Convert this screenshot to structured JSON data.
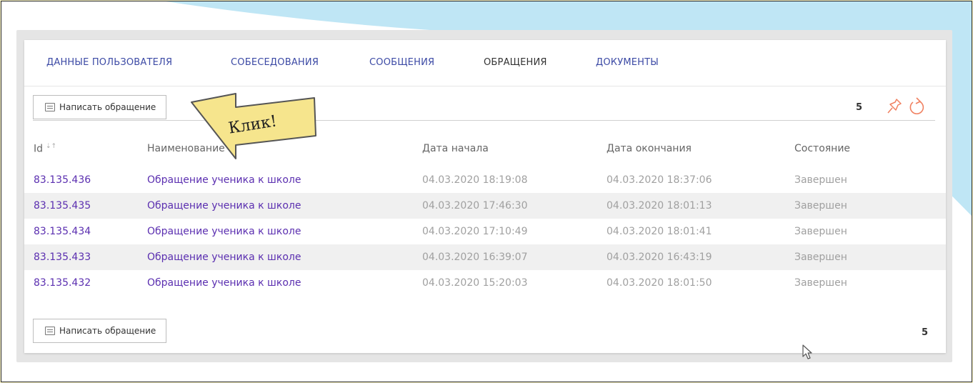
{
  "tabs": [
    {
      "label": "ДАННЫЕ ПОЛЬЗОВАТЕЛЯ",
      "active": false
    },
    {
      "label": "СОБЕСЕДОВАНИЯ",
      "active": false
    },
    {
      "label": "СООБЩЕНИЯ",
      "active": false
    },
    {
      "label": "ОБРАЩЕНИЯ",
      "active": true
    },
    {
      "label": "ДОКУМЕНТЫ",
      "active": false
    }
  ],
  "toolbar": {
    "write_button_label": "Написать обращение",
    "total_count": "5"
  },
  "table": {
    "columns": [
      "Id",
      "Наименование",
      "Дата начала",
      "Дата окончания",
      "Состояние"
    ],
    "rows": [
      {
        "id": "83.135.436",
        "name": "Обращение ученика к школе",
        "start": "04.03.2020 18:19:08",
        "end": "04.03.2020 18:37:06",
        "state": "Завершен"
      },
      {
        "id": "83.135.435",
        "name": "Обращение ученика к школе",
        "start": "04.03.2020 17:46:30",
        "end": "04.03.2020 18:01:13",
        "state": "Завершен"
      },
      {
        "id": "83.135.434",
        "name": "Обращение ученика к школе",
        "start": "04.03.2020 17:10:49",
        "end": "04.03.2020 18:01:41",
        "state": "Завершен"
      },
      {
        "id": "83.135.433",
        "name": "Обращение ученика к школе",
        "start": "04.03.2020 16:39:07",
        "end": "04.03.2020 16:43:19",
        "state": "Завершен"
      },
      {
        "id": "83.135.432",
        "name": "Обращение ученика к школе",
        "start": "04.03.2020 15:20:03",
        "end": "04.03.2020 18:01:50",
        "state": "Завершен"
      }
    ]
  },
  "footer": {
    "write_button_label": "Написать обращение",
    "total_count": "5"
  },
  "annotation": {
    "text": "Клик!"
  },
  "icons": {
    "message": "message-icon",
    "sort": "sort-icon",
    "pin": "pin-icon",
    "refresh": "refresh-icon",
    "cursor": "mouse-cursor-icon"
  },
  "colors": {
    "tab_link": "#3c4aa5",
    "row_link": "#5b2fb0",
    "muted_text": "#a0a0a0",
    "accent_icon": "#f08060",
    "callout_fill": "#f6e58d",
    "page_bg": "#fffacd",
    "banner_bg": "#bfe6f5"
  }
}
